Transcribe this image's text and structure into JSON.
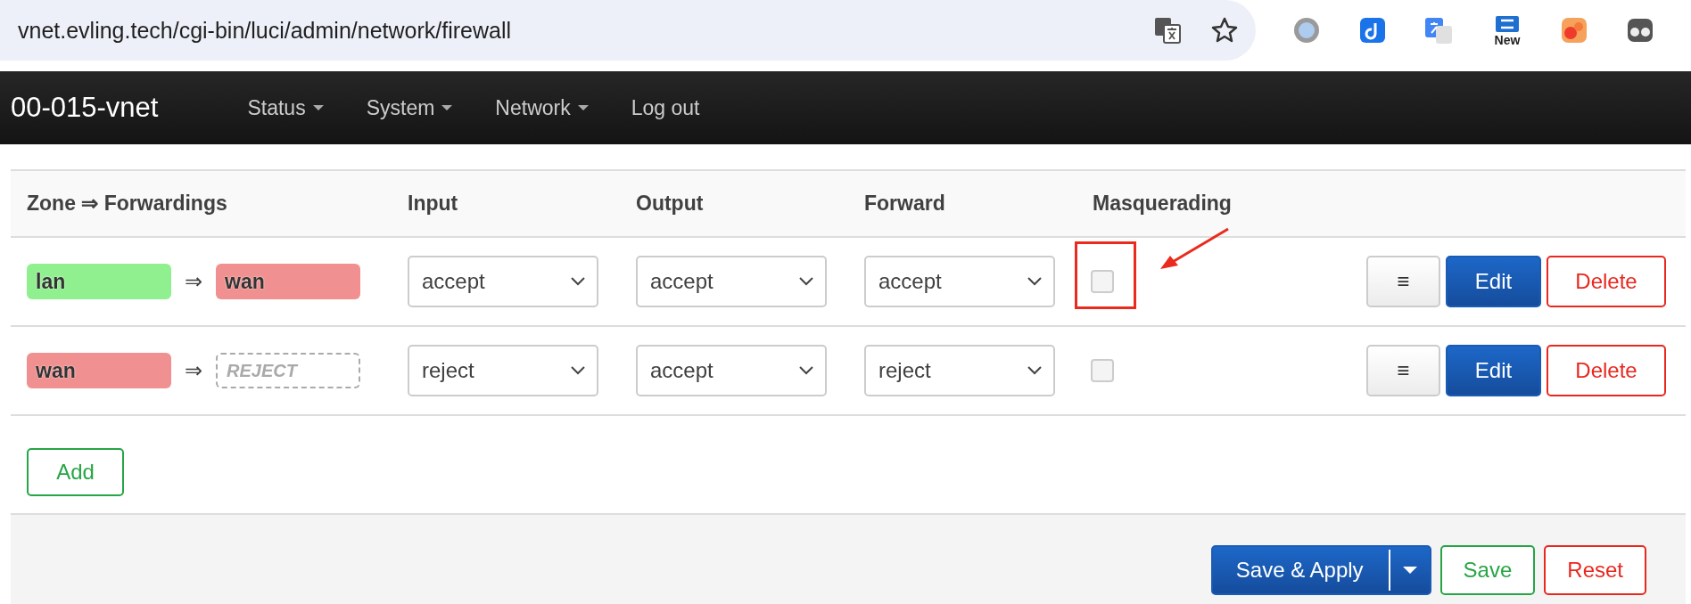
{
  "browser": {
    "url": "vnet.evling.tech/cgi-bin/luci/admin/network/firewall",
    "extension_badge": "New"
  },
  "navbar": {
    "brand": "00-015-vnet",
    "menu": [
      {
        "label": "Status",
        "dropdown": true
      },
      {
        "label": "System",
        "dropdown": true
      },
      {
        "label": "Network",
        "dropdown": true
      },
      {
        "label": "Log out",
        "dropdown": false
      }
    ]
  },
  "table": {
    "columns": [
      "Zone ⇒ Forwardings",
      "Input",
      "Output",
      "Forward",
      "Masquerading"
    ],
    "rows": [
      {
        "zone": {
          "name": "lan",
          "color": "#90f090"
        },
        "arrow": "⇒",
        "forwarding": {
          "kind": "zone",
          "name": "wan",
          "color": "#f09090"
        },
        "input": "accept",
        "output": "accept",
        "forward": "accept",
        "masquerading": {
          "checked": false
        },
        "highlighted": true,
        "actions": [
          {
            "kind": "neutral",
            "label": "≡"
          },
          {
            "kind": "primary",
            "label": "Edit"
          },
          {
            "kind": "negative",
            "label": "Delete"
          }
        ]
      },
      {
        "zone": {
          "name": "wan",
          "color": "#f09090"
        },
        "arrow": "⇒",
        "forwarding": {
          "kind": "policy",
          "name": "REJECT"
        },
        "input": "reject",
        "output": "accept",
        "forward": "reject",
        "masquerading": {
          "checked": false
        },
        "highlighted": false,
        "actions": [
          {
            "kind": "neutral",
            "label": "≡"
          },
          {
            "kind": "primary",
            "label": "Edit"
          },
          {
            "kind": "negative",
            "label": "Delete"
          }
        ]
      }
    ]
  },
  "add_button": "Add",
  "footer": {
    "buttons": [
      {
        "kind": "primary",
        "label": "Save & Apply",
        "dropdown": true
      },
      {
        "kind": "positive",
        "label": "Save",
        "dropdown": false
      },
      {
        "kind": "negative",
        "label": "Reset",
        "dropdown": false
      }
    ]
  }
}
